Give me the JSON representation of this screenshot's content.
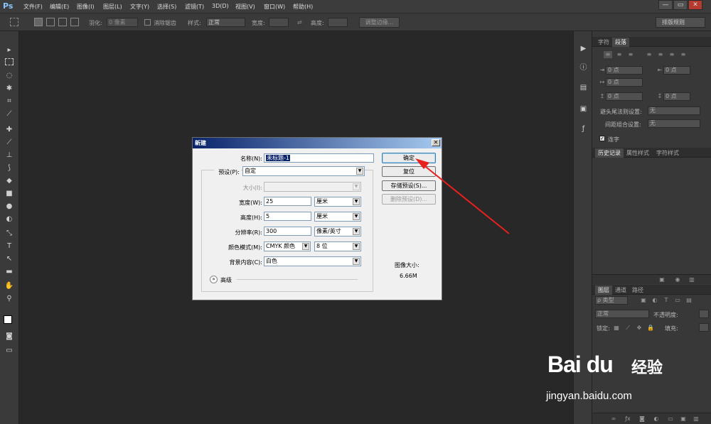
{
  "app": {
    "logo": "Ps",
    "menu": [
      "文件(F)",
      "编辑(E)",
      "图像(I)",
      "图层(L)",
      "文字(Y)",
      "选择(S)",
      "滤镜(T)",
      "3D(D)",
      "视图(V)",
      "窗口(W)",
      "帮助(H)"
    ],
    "window_controls": {
      "minimize": "—",
      "restore": "▭",
      "close": "✕"
    }
  },
  "options": {
    "feather_label": "羽化:",
    "feather_value": "0 像素",
    "antialias_label": "消除锯齿",
    "style_label": "样式:",
    "style_value": "正常",
    "width_label": "宽度:",
    "height_label": "高度:",
    "refine_edge": "调整边缘...",
    "workspace": "排版规则"
  },
  "tools": [
    "move",
    "marquee",
    "lasso",
    "quick-select",
    "crop",
    "eyedropper",
    "healing",
    "brush",
    "clone-stamp",
    "history-brush",
    "eraser",
    "gradient",
    "blur",
    "dodge",
    "pen",
    "type",
    "path-select",
    "rectangle",
    "hand",
    "zoom"
  ],
  "character_panel": {
    "tabs": [
      "字符",
      "段落"
    ],
    "active_tab": "段落",
    "fields": {
      "indent_left": "0 点",
      "indent_right": "0 点",
      "indent_first": "0 点",
      "space_before": "0 点",
      "space_after": "0 点"
    },
    "kinsoku_label": "避头尾法则设置:",
    "kinsoku_value": "无",
    "mojikumi_label": "间距组合设置:",
    "mojikumi_value": "无",
    "hyphenate_label": "连字"
  },
  "history_panel": {
    "tabs": [
      "历史记录",
      "属性样式",
      "字符样式"
    ]
  },
  "layers_panel": {
    "tabs": [
      "图层",
      "通道",
      "路径"
    ],
    "filter_label": "ρ 类型",
    "blend_mode": "正常",
    "opacity_label": "不透明度:",
    "lock_label": "锁定:",
    "fill_label": "填充:"
  },
  "dialog": {
    "title": "新建",
    "close": "✕",
    "name_label": "名称(N):",
    "name_value": "未标题-1",
    "preset_label": "预设(P):",
    "preset_value": "自定",
    "size_label": "大小(I):",
    "width_label": "宽度(W):",
    "width_value": "25",
    "width_unit": "厘米",
    "height_label": "高度(H):",
    "height_value": "5",
    "height_unit": "厘米",
    "resolution_label": "分辨率(R):",
    "resolution_value": "300",
    "resolution_unit": "像素/英寸",
    "color_mode_label": "颜色模式(M):",
    "color_mode_value": "CMYK 颜色",
    "bit_depth_value": "8 位",
    "background_label": "背景内容(C):",
    "background_value": "白色",
    "advanced_label": "高级",
    "ok_button": "确定",
    "reset_button": "复位",
    "save_preset_button": "存储预设(S)...",
    "delete_preset_button": "删除预设(D)...",
    "image_size_label": "图像大小:",
    "image_size_value": "6.66M"
  },
  "watermark": {
    "logo": "Bai du",
    "cn": "经验",
    "url": "jingyan.baidu.com"
  },
  "colors": {
    "arrow": "#e82020",
    "dialog_title_start": "#0a246a",
    "dialog_title_end": "#a6caf0"
  }
}
